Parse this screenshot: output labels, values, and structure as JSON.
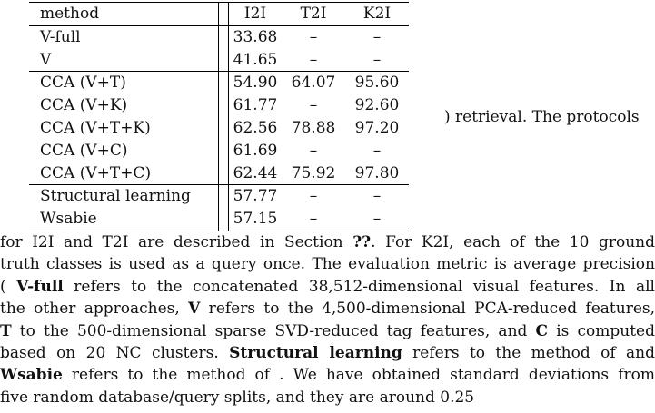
{
  "table": {
    "columns": [
      "method",
      "I2I",
      "T2I",
      "K2I"
    ],
    "rows": [
      {
        "method": "V-full",
        "i2i": "33.68",
        "t2i": "–",
        "k2i": "–",
        "group": 1
      },
      {
        "method": "V",
        "i2i": "41.65",
        "t2i": "–",
        "k2i": "–",
        "group": 1
      },
      {
        "method": "CCA (V+T)",
        "i2i": "54.90",
        "t2i": "64.07",
        "k2i": "95.60",
        "group": 2
      },
      {
        "method": "CCA (V+K)",
        "i2i": "61.77",
        "t2i": "–",
        "k2i": "92.60",
        "group": 2
      },
      {
        "method": "CCA (V+T+K)",
        "i2i": "62.56",
        "t2i": "78.88",
        "k2i": "97.20",
        "group": 2
      },
      {
        "method": "CCA (V+C)",
        "i2i": "61.69",
        "t2i": "–",
        "k2i": "–",
        "group": 2
      },
      {
        "method": "CCA (V+T+C)",
        "i2i": "62.44",
        "t2i": "75.92",
        "k2i": "97.80",
        "group": 2
      },
      {
        "method": "Structural learning",
        "i2i": "57.77",
        "t2i": "–",
        "k2i": "–",
        "group": 3
      },
      {
        "method": "Wsabie",
        "i2i": "57.15",
        "t2i": "–",
        "k2i": "–",
        "group": 3
      }
    ]
  },
  "caption_right": ") retrieval. The protocols",
  "paragraph": {
    "l1": "for I2I and T2I are described in Section ",
    "l1_bold": "??",
    "l1_end": ". For K2I, each of the 10 ground",
    "l2": "truth classes is used as a query once. The evaluation metric is average precision",
    "l3_a": "( ",
    "l3_bold": "V-full",
    "l3_b": " refers to the concatenated 38,512-dimensional visual features. In all",
    "l4_a": "the other approaches, ",
    "l4_bold": "V",
    "l4_b": " refers to the 4,500-dimensional PCA-reduced features,",
    "l5_bold": "T",
    "l5_b": " to the 500-dimensional sparse SVD-reduced tag features, and ",
    "l5_bold2": "C",
    "l5_c": " is computed",
    "l6_a": "based on 20 NC clusters. ",
    "l6_bold": "Structural learning",
    "l6_b": " refers to the method of  and",
    "l7_bold": "Wsabie",
    "l7_b": " refers to the method of . We have obtained standard deviations from",
    "l8": "five random database/query splits, and they are around 0.25"
  }
}
